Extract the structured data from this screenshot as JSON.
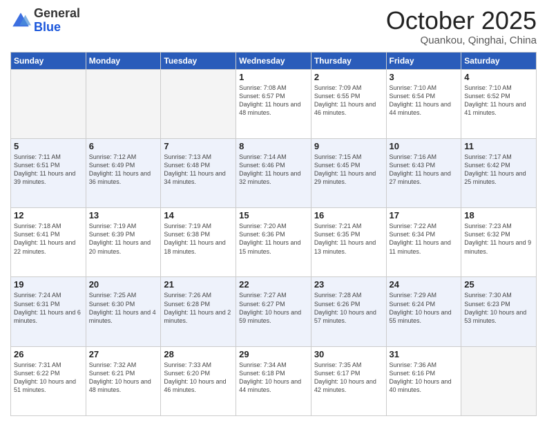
{
  "logo": {
    "general": "General",
    "blue": "Blue"
  },
  "header": {
    "title": "October 2025",
    "subtitle": "Quankou, Qinghai, China"
  },
  "weekdays": [
    "Sunday",
    "Monday",
    "Tuesday",
    "Wednesday",
    "Thursday",
    "Friday",
    "Saturday"
  ],
  "weeks": [
    {
      "bg": "odd",
      "days": [
        {
          "num": "",
          "info": "",
          "empty": true
        },
        {
          "num": "",
          "info": "",
          "empty": true
        },
        {
          "num": "",
          "info": "",
          "empty": true
        },
        {
          "num": "1",
          "info": "Sunrise: 7:08 AM\nSunset: 6:57 PM\nDaylight: 11 hours and 48 minutes."
        },
        {
          "num": "2",
          "info": "Sunrise: 7:09 AM\nSunset: 6:55 PM\nDaylight: 11 hours and 46 minutes."
        },
        {
          "num": "3",
          "info": "Sunrise: 7:10 AM\nSunset: 6:54 PM\nDaylight: 11 hours and 44 minutes."
        },
        {
          "num": "4",
          "info": "Sunrise: 7:10 AM\nSunset: 6:52 PM\nDaylight: 11 hours and 41 minutes."
        }
      ]
    },
    {
      "bg": "even",
      "days": [
        {
          "num": "5",
          "info": "Sunrise: 7:11 AM\nSunset: 6:51 PM\nDaylight: 11 hours and 39 minutes."
        },
        {
          "num": "6",
          "info": "Sunrise: 7:12 AM\nSunset: 6:49 PM\nDaylight: 11 hours and 36 minutes."
        },
        {
          "num": "7",
          "info": "Sunrise: 7:13 AM\nSunset: 6:48 PM\nDaylight: 11 hours and 34 minutes."
        },
        {
          "num": "8",
          "info": "Sunrise: 7:14 AM\nSunset: 6:46 PM\nDaylight: 11 hours and 32 minutes."
        },
        {
          "num": "9",
          "info": "Sunrise: 7:15 AM\nSunset: 6:45 PM\nDaylight: 11 hours and 29 minutes."
        },
        {
          "num": "10",
          "info": "Sunrise: 7:16 AM\nSunset: 6:43 PM\nDaylight: 11 hours and 27 minutes."
        },
        {
          "num": "11",
          "info": "Sunrise: 7:17 AM\nSunset: 6:42 PM\nDaylight: 11 hours and 25 minutes."
        }
      ]
    },
    {
      "bg": "odd",
      "days": [
        {
          "num": "12",
          "info": "Sunrise: 7:18 AM\nSunset: 6:41 PM\nDaylight: 11 hours and 22 minutes."
        },
        {
          "num": "13",
          "info": "Sunrise: 7:19 AM\nSunset: 6:39 PM\nDaylight: 11 hours and 20 minutes."
        },
        {
          "num": "14",
          "info": "Sunrise: 7:19 AM\nSunset: 6:38 PM\nDaylight: 11 hours and 18 minutes."
        },
        {
          "num": "15",
          "info": "Sunrise: 7:20 AM\nSunset: 6:36 PM\nDaylight: 11 hours and 15 minutes."
        },
        {
          "num": "16",
          "info": "Sunrise: 7:21 AM\nSunset: 6:35 PM\nDaylight: 11 hours and 13 minutes."
        },
        {
          "num": "17",
          "info": "Sunrise: 7:22 AM\nSunset: 6:34 PM\nDaylight: 11 hours and 11 minutes."
        },
        {
          "num": "18",
          "info": "Sunrise: 7:23 AM\nSunset: 6:32 PM\nDaylight: 11 hours and 9 minutes."
        }
      ]
    },
    {
      "bg": "even",
      "days": [
        {
          "num": "19",
          "info": "Sunrise: 7:24 AM\nSunset: 6:31 PM\nDaylight: 11 hours and 6 minutes."
        },
        {
          "num": "20",
          "info": "Sunrise: 7:25 AM\nSunset: 6:30 PM\nDaylight: 11 hours and 4 minutes."
        },
        {
          "num": "21",
          "info": "Sunrise: 7:26 AM\nSunset: 6:28 PM\nDaylight: 11 hours and 2 minutes."
        },
        {
          "num": "22",
          "info": "Sunrise: 7:27 AM\nSunset: 6:27 PM\nDaylight: 10 hours and 59 minutes."
        },
        {
          "num": "23",
          "info": "Sunrise: 7:28 AM\nSunset: 6:26 PM\nDaylight: 10 hours and 57 minutes."
        },
        {
          "num": "24",
          "info": "Sunrise: 7:29 AM\nSunset: 6:24 PM\nDaylight: 10 hours and 55 minutes."
        },
        {
          "num": "25",
          "info": "Sunrise: 7:30 AM\nSunset: 6:23 PM\nDaylight: 10 hours and 53 minutes."
        }
      ]
    },
    {
      "bg": "odd",
      "days": [
        {
          "num": "26",
          "info": "Sunrise: 7:31 AM\nSunset: 6:22 PM\nDaylight: 10 hours and 51 minutes."
        },
        {
          "num": "27",
          "info": "Sunrise: 7:32 AM\nSunset: 6:21 PM\nDaylight: 10 hours and 48 minutes."
        },
        {
          "num": "28",
          "info": "Sunrise: 7:33 AM\nSunset: 6:20 PM\nDaylight: 10 hours and 46 minutes."
        },
        {
          "num": "29",
          "info": "Sunrise: 7:34 AM\nSunset: 6:18 PM\nDaylight: 10 hours and 44 minutes."
        },
        {
          "num": "30",
          "info": "Sunrise: 7:35 AM\nSunset: 6:17 PM\nDaylight: 10 hours and 42 minutes."
        },
        {
          "num": "31",
          "info": "Sunrise: 7:36 AM\nSunset: 6:16 PM\nDaylight: 10 hours and 40 minutes."
        },
        {
          "num": "",
          "info": "",
          "empty": true
        }
      ]
    }
  ]
}
